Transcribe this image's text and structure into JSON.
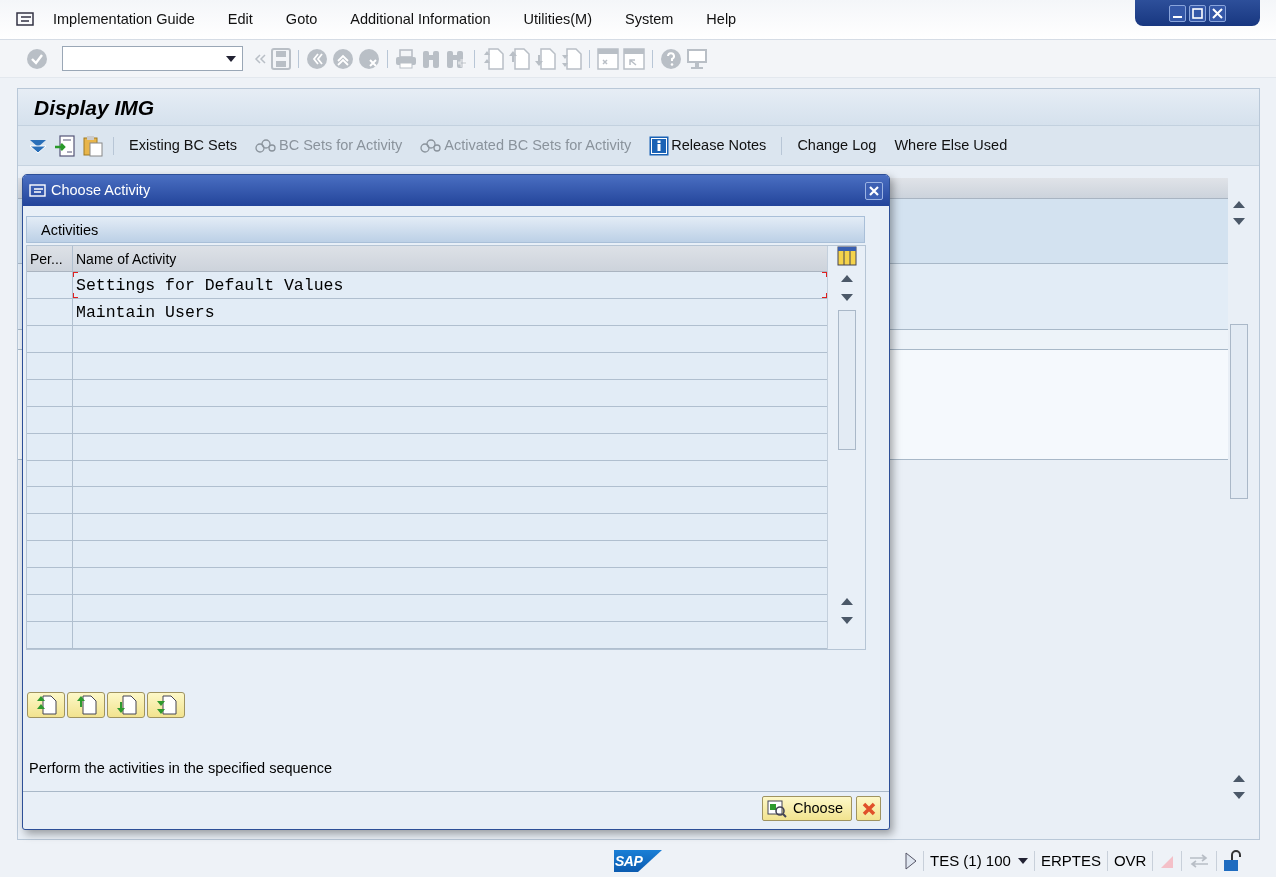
{
  "menu_bar": {
    "items": [
      "Implementation Guide",
      "Edit",
      "Goto",
      "Additional Information",
      "Utilities(M)",
      "System",
      "Help"
    ]
  },
  "title": "Display IMG",
  "app_toolbar": {
    "items": [
      {
        "label": "Existing BC Sets",
        "disabled": false,
        "kind": "text"
      },
      {
        "label": "BC Sets for Activity",
        "disabled": true,
        "kind": "bcset"
      },
      {
        "label": "Activated BC Sets for Activity",
        "disabled": true,
        "kind": "bcset"
      },
      {
        "label": "Release Notes",
        "disabled": false,
        "kind": "info"
      },
      {
        "label": "Change Log",
        "disabled": false,
        "kind": "text"
      },
      {
        "label": "Where Else Used",
        "disabled": false,
        "kind": "text"
      }
    ]
  },
  "dialog": {
    "title": "Choose Activity",
    "section_title": "Activities",
    "columns": [
      "Per...",
      "Name of Activity"
    ],
    "rows": [
      {
        "name": "Settings for Default Values",
        "selected": true
      },
      {
        "name": "Maintain Users",
        "selected": false
      }
    ],
    "hint": "Perform the activities in the specified sequence",
    "choose_button": "Choose"
  },
  "status_bar": {
    "logo": "SAP",
    "session": "TES (1) 100",
    "server": "ERPTES",
    "mode": "OVR"
  }
}
